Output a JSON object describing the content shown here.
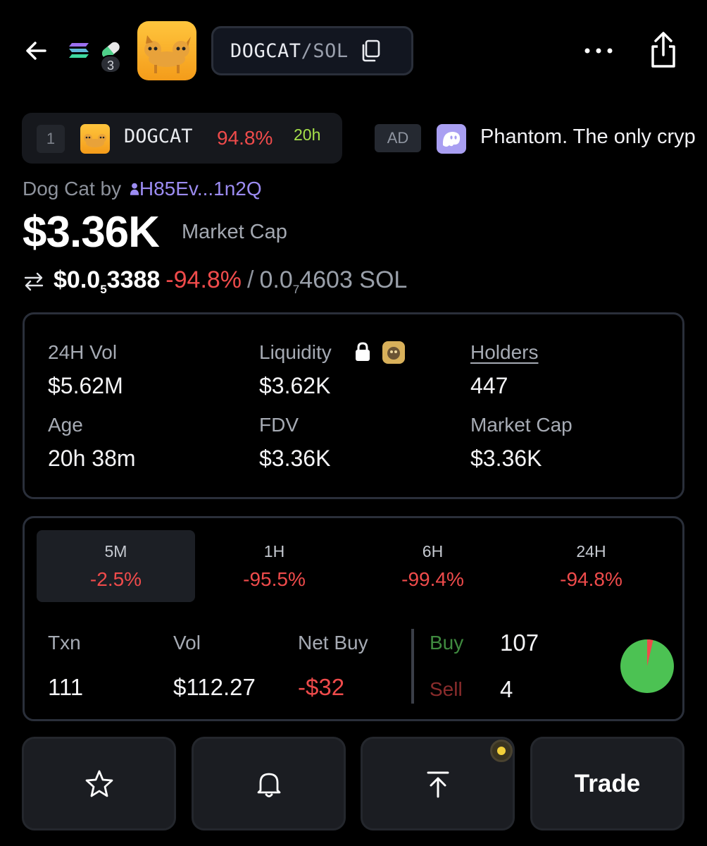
{
  "header": {
    "pair_base": "DOGCAT",
    "pair_sep": "/",
    "pair_quote": "SOL",
    "badge_count": "3"
  },
  "trending": {
    "rank": "1",
    "name": "DOGCAT",
    "change": "94.8%",
    "age": "20h"
  },
  "ad": {
    "badge": "AD",
    "text": "Phantom. The only cryp"
  },
  "token": {
    "name_prefix": "Dog Cat by",
    "creator": "H85Ev...1n2Q",
    "market_cap": "$3.36K",
    "market_cap_label": "Market Cap",
    "price_usd_main": "$0.0",
    "price_usd_sub": "5",
    "price_usd_tail": "3388",
    "price_change": "-94.8%",
    "price_sep": "/",
    "price_sol_main": "0.0",
    "price_sol_sub": "7",
    "price_sol_tail": "4603 SOL"
  },
  "stats": {
    "vol_label": "24H Vol",
    "vol_value": "$5.62M",
    "liq_label": "Liquidity",
    "liq_value": "$3.62K",
    "holders_label": "Holders",
    "holders_value": "447",
    "age_label": "Age",
    "age_value": "20h 38m",
    "fdv_label": "FDV",
    "fdv_value": "$3.36K",
    "mcap_label": "Market Cap",
    "mcap_value": "$3.36K"
  },
  "timeframes": [
    {
      "label": "5M",
      "change": "-2.5%"
    },
    {
      "label": "1H",
      "change": "-95.5%"
    },
    {
      "label": "6H",
      "change": "-99.4%"
    },
    {
      "label": "24H",
      "change": "-94.8%"
    }
  ],
  "txns": {
    "txn_label": "Txn",
    "txn_value": "111",
    "vol_label": "Vol",
    "vol_value": "$112.27",
    "netbuy_label": "Net Buy",
    "netbuy_value": "-$32",
    "buy_label": "Buy",
    "buy_value": "107",
    "sell_label": "Sell",
    "sell_value": "4"
  },
  "buy_sell_ratio": {
    "buy": 107,
    "sell": 4
  },
  "actions": {
    "trade_label": "Trade"
  },
  "colors": {
    "positive": "#4cc253",
    "negative": "#ef4b4b",
    "accent": "#9c8cf2",
    "age_green": "#a6e04a"
  },
  "icons": [
    "back-arrow-icon",
    "solana-icon",
    "pill-icon",
    "copy-icon",
    "more-icon",
    "share-icon",
    "lock-icon",
    "star-icon",
    "bell-icon",
    "boost-icon",
    "swap-icon",
    "user-icon"
  ]
}
